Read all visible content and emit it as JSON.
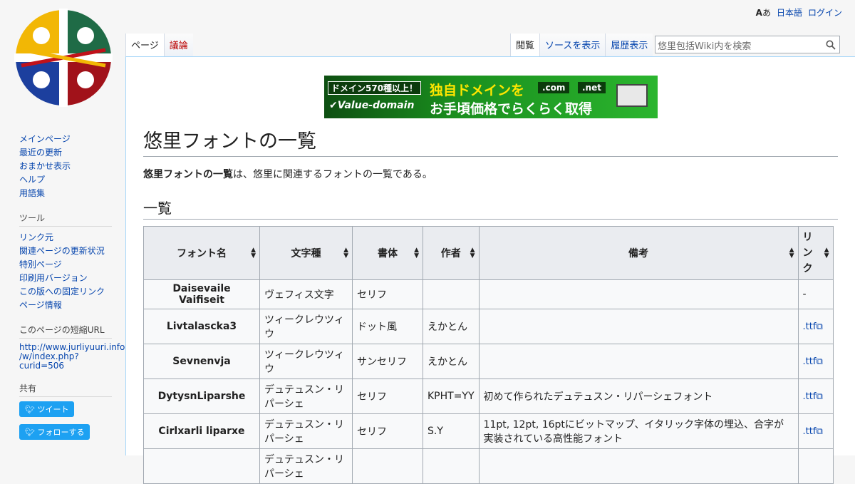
{
  "personal": {
    "language": "日本語",
    "login": "ログイン"
  },
  "tabs_left": [
    {
      "label": "ページ"
    },
    {
      "label": "議論"
    }
  ],
  "tabs_right": [
    {
      "label": "閲覧"
    },
    {
      "label": "ソースを表示"
    },
    {
      "label": "履歴表示"
    }
  ],
  "search": {
    "placeholder": "悠里包括Wiki内を検索"
  },
  "banner": {
    "badge": "ドメイン570種以上！",
    "brand": "Value-domain",
    "headline": "独自ドメインを",
    "subline": "お手頃価格でらくらく取得",
    "tld1": ".com",
    "tld2": ".net"
  },
  "nav": {
    "main": [
      "メインページ",
      "最近の更新",
      "おまかせ表示",
      "ヘルプ",
      "用語集"
    ],
    "tools_title": "ツール",
    "tools": [
      "リンク元",
      "関連ページの更新状況",
      "特別ページ",
      "印刷用バージョン",
      "この版への固定リンク",
      "ページ情報"
    ],
    "shorturl_title": "このページの短縮URL",
    "shorturl_lines": [
      "http://www.jurliyuuri.info",
      "/w/index.php?",
      "curid=506"
    ],
    "share_title": "共有",
    "tweet": "ツイート",
    "follow": "フォローする"
  },
  "page": {
    "title": "悠里フォントの一覧",
    "intro_bold": "悠里フォントの一覧",
    "intro_rest": "は、悠里に関連するフォントの一覧である。",
    "section": "一覧"
  },
  "table": {
    "headers": [
      "フォント名",
      "文字種",
      "書体",
      "作者",
      "備考",
      "リンク"
    ],
    "rows": [
      {
        "name": "Daisevaile Vaifiseit",
        "script": "ヴェフィス文字",
        "style": "セリフ",
        "author": "",
        "note": "",
        "link": "-"
      },
      {
        "name": "Livtalascka3",
        "script": "ツィークレウツィウ",
        "style": "ドット風",
        "author": "えかとん",
        "note": "",
        "link": ".ttf"
      },
      {
        "name": "Sevnenvja",
        "script": "ツィークレウツィウ",
        "style": "サンセリフ",
        "author": "えかとん",
        "note": "",
        "link": ".ttf"
      },
      {
        "name": "DytysnLiparshe",
        "script": "デュテュスン・リパーシェ",
        "style": "セリフ",
        "author": "KPHT=YY",
        "note": "初めて作られたデュテュスン・リパーシェフォント",
        "link": ".ttf"
      },
      {
        "name": "Cirlxarli liparxe",
        "script": "デュテュスン・リパーシェ",
        "style": "セリフ",
        "author": "S.Y",
        "note": "11pt, 12pt, 16ptにビットマップ、イタリック字体の埋込、合字が実装されている高性能フォント",
        "link": ".ttf"
      },
      {
        "name": "",
        "script": "デュテュスン・リパーシェ",
        "style": "",
        "author": "",
        "note": "",
        "link": ""
      }
    ]
  },
  "colors": {
    "link": "#0645ad",
    "new_link": "#ba0000",
    "border": "#a2a9b1",
    "header_bg": "#eaecf0"
  }
}
